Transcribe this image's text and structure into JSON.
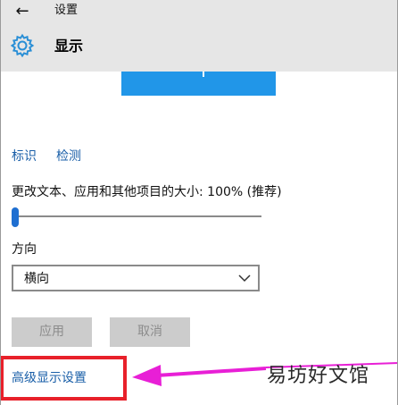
{
  "window": {
    "title": "设置"
  },
  "header": {
    "back_icon": "back-arrow-icon",
    "page_icon": "gear-icon",
    "page_title": "显示"
  },
  "colors": {
    "accent": "#2196e8",
    "link": "#1a5fa8",
    "highlight": "#e8202a",
    "arrow": "#e81fd6",
    "header_bg": "#e6e6e6"
  },
  "links": {
    "identify": "标识",
    "detect": "检测"
  },
  "scale": {
    "label": "更改文本、应用和其他项目的大小: 100% (推荐)",
    "value": 0
  },
  "orientation": {
    "label": "方向",
    "selected": "横向"
  },
  "buttons": {
    "apply": "应用",
    "cancel": "取消"
  },
  "advanced_link": "高级显示设置",
  "watermark": "易坊好文馆"
}
